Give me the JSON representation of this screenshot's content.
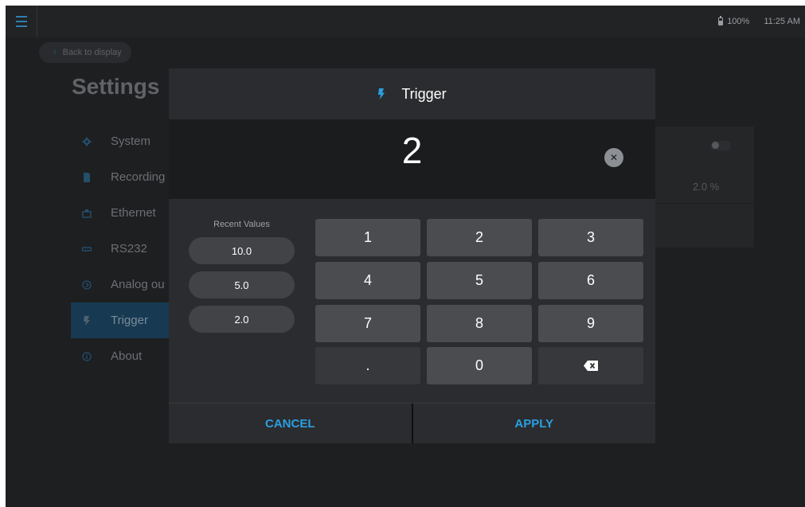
{
  "status_bar": {
    "battery": "100%",
    "time": "11:25 AM"
  },
  "background": {
    "back_label": "Back to display",
    "page_title": "Settings",
    "sidebar_items": [
      {
        "label": "System",
        "icon": "gear-icon"
      },
      {
        "label": "Recording",
        "icon": "document-icon"
      },
      {
        "label": "Ethernet",
        "icon": "ethernet-icon"
      },
      {
        "label": "RS232",
        "icon": "serial-icon"
      },
      {
        "label": "Analog ou",
        "icon": "analog-icon"
      },
      {
        "label": "Trigger",
        "icon": "bolt-icon",
        "active": true
      },
      {
        "label": "About",
        "icon": "info-icon"
      }
    ],
    "right_panel": {
      "value": "2.0 %"
    }
  },
  "dialog": {
    "title": "Trigger",
    "value": "2",
    "recent_label": "Recent Values",
    "recent_values": [
      "10.0",
      "5.0",
      "2.0"
    ],
    "keys": [
      "1",
      "2",
      "3",
      "4",
      "5",
      "6",
      "7",
      "8",
      "9",
      ".",
      "0"
    ],
    "cancel_label": "CANCEL",
    "apply_label": "APPLY"
  },
  "colors": {
    "accent": "#2a9fe0",
    "background": "#1e1f21",
    "dialog": "#2b2c2f",
    "key": "#4a4c50",
    "active_sidebar": "#173a52"
  }
}
